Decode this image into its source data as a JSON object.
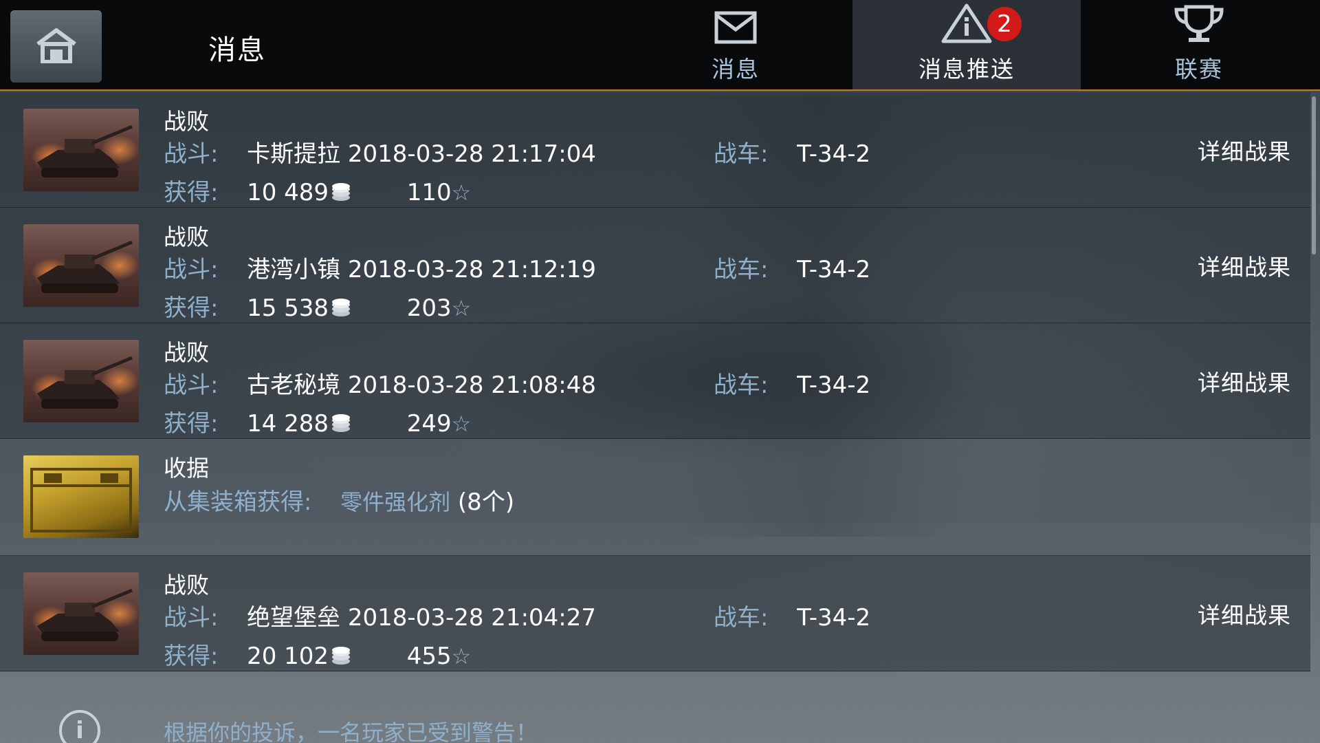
{
  "header": {
    "title": "消息",
    "tabs": [
      {
        "label": "消息",
        "icon": "envelope-icon",
        "active": false
      },
      {
        "label": "消息推送",
        "icon": "warning-icon",
        "active": true,
        "badge": "2"
      },
      {
        "label": "联赛",
        "icon": "trophy-icon",
        "active": false
      }
    ]
  },
  "messages": [
    {
      "title": "战败",
      "battle_label": "战斗:",
      "battle_value": "卡斯提拉 2018-03-28 21:17:04",
      "tank_label": "战车:",
      "tank_value": "T-34-2",
      "earn_label": "获得:",
      "silver": "10 489",
      "xp": "110",
      "detail": "详细战果"
    },
    {
      "title": "战败",
      "battle_label": "战斗:",
      "battle_value": "港湾小镇 2018-03-28 21:12:19",
      "tank_label": "战车:",
      "tank_value": "T-34-2",
      "earn_label": "获得:",
      "silver": "15 538",
      "xp": "203",
      "detail": "详细战果"
    },
    {
      "title": "战败",
      "battle_label": "战斗:",
      "battle_value": "古老秘境 2018-03-28 21:08:48",
      "tank_label": "战车:",
      "tank_value": "T-34-2",
      "earn_label": "获得:",
      "silver": "14 288",
      "xp": "249",
      "detail": "详细战果"
    },
    {
      "title": "收据",
      "source_label": "从集装箱获得:",
      "item_name": "零件强化剂",
      "item_count": "(8个)"
    },
    {
      "title": "战败",
      "battle_label": "战斗:",
      "battle_value": "绝望堡垒 2018-03-28 21:04:27",
      "tank_label": "战车:",
      "tank_value": "T-34-2",
      "earn_label": "获得:",
      "silver": "20 102",
      "xp": "455",
      "detail": "详细战果"
    }
  ],
  "notice": {
    "text": "根据你的投诉，一名玩家已受到警告！"
  },
  "colors": {
    "accent_orange": "#c77a1e",
    "label_blue": "#8fb0cc",
    "badge_red": "#d21a1a"
  }
}
